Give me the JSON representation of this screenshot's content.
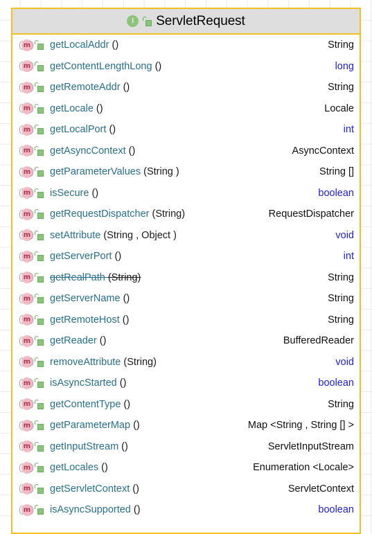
{
  "node": {
    "title": "ServletRequest",
    "type_icon": "interface-icon",
    "type_icon_letter": "I",
    "visibility_icon": "unlocked-padlock-icon",
    "border_color": "#f2c021",
    "header_bg": "#dededf",
    "body_bg": "#ffffff"
  },
  "colors": {
    "method_name": "#27708f",
    "param_text": "#1a1a1a",
    "return_object": "#101010",
    "return_primitive": "#2121d6",
    "method_icon_fill": "#f6b9c4",
    "lock_icon_fill": "#8cc47c"
  },
  "members": [
    {
      "name": "getLocalAddr",
      "params": "()",
      "return": "String",
      "primitive": false,
      "deprecated": false
    },
    {
      "name": "getContentLengthLong",
      "params": "()",
      "return": "long",
      "primitive": true,
      "deprecated": false
    },
    {
      "name": "getRemoteAddr",
      "params": "()",
      "return": "String",
      "primitive": false,
      "deprecated": false
    },
    {
      "name": "getLocale",
      "params": "()",
      "return": "Locale",
      "primitive": false,
      "deprecated": false
    },
    {
      "name": "getLocalPort",
      "params": "()",
      "return": "int",
      "primitive": true,
      "deprecated": false
    },
    {
      "name": "getAsyncContext",
      "params": "()",
      "return": "AsyncContext",
      "primitive": false,
      "deprecated": false
    },
    {
      "name": "getParameterValues",
      "params": "(String )",
      "return": "String []",
      "primitive": false,
      "deprecated": false
    },
    {
      "name": "isSecure",
      "params": "()",
      "return": "boolean",
      "primitive": true,
      "deprecated": false
    },
    {
      "name": "getRequestDispatcher",
      "params": "(String)",
      "return": "RequestDispatcher",
      "primitive": false,
      "deprecated": false
    },
    {
      "name": "setAttribute",
      "params": "(String , Object )",
      "return": "void",
      "primitive": true,
      "deprecated": false
    },
    {
      "name": "getServerPort",
      "params": "()",
      "return": "int",
      "primitive": true,
      "deprecated": false
    },
    {
      "name": "getRealPath",
      "params": "(String)",
      "return": "String",
      "primitive": false,
      "deprecated": true
    },
    {
      "name": "getServerName",
      "params": "()",
      "return": "String",
      "primitive": false,
      "deprecated": false
    },
    {
      "name": "getRemoteHost",
      "params": "()",
      "return": "String",
      "primitive": false,
      "deprecated": false
    },
    {
      "name": "getReader",
      "params": "()",
      "return": "BufferedReader",
      "primitive": false,
      "deprecated": false
    },
    {
      "name": "removeAttribute",
      "params": "(String)",
      "return": "void",
      "primitive": true,
      "deprecated": false
    },
    {
      "name": "isAsyncStarted",
      "params": "()",
      "return": "boolean",
      "primitive": true,
      "deprecated": false
    },
    {
      "name": "getContentType",
      "params": "()",
      "return": "String",
      "primitive": false,
      "deprecated": false
    },
    {
      "name": "getParameterMap",
      "params": "()",
      "return": "Map <String , String [] >",
      "primitive": false,
      "deprecated": false
    },
    {
      "name": "getInputStream",
      "params": "()",
      "return": "ServletInputStream",
      "primitive": false,
      "deprecated": false
    },
    {
      "name": "getLocales",
      "params": "()",
      "return": "Enumeration <Locale>",
      "primitive": false,
      "deprecated": false
    },
    {
      "name": "getServletContext",
      "params": "()",
      "return": "ServletContext",
      "primitive": false,
      "deprecated": false
    },
    {
      "name": "isAsyncSupported",
      "params": "()",
      "return": "boolean",
      "primitive": true,
      "deprecated": false
    }
  ]
}
